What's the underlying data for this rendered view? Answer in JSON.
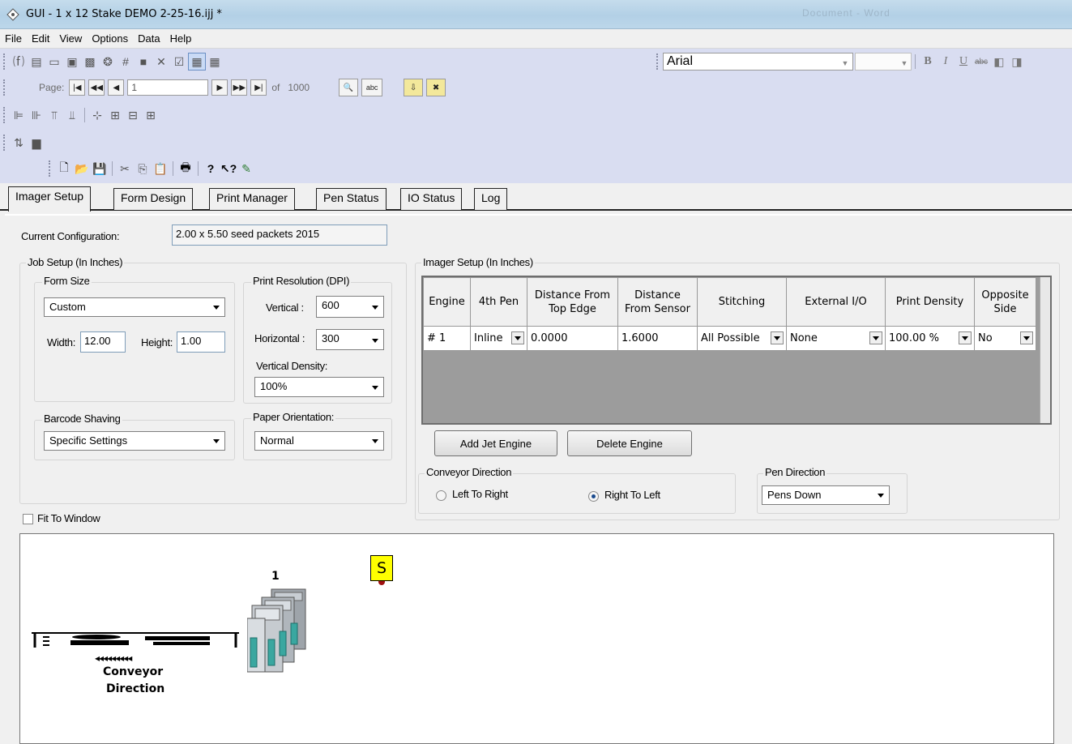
{
  "window": {
    "title": "GUI - 1 x 12 Stake DEMO 2-25-16.ijj *",
    "ghost_title": "Document - Word"
  },
  "menu": [
    "File",
    "Edit",
    "View",
    "Options",
    "Data",
    "Help"
  ],
  "toolbar": {
    "font_name": "Arial",
    "page_label": "Page:",
    "page_value": "1",
    "of_label": "of",
    "total_pages": "1000",
    "abc_label": "abc",
    "format_icons": [
      "bold-icon",
      "italic-icon",
      "underline-icon",
      "strikethrough-icon"
    ]
  },
  "tabs": [
    "Imager Setup",
    "Form Design",
    "Print Manager",
    "Pen Status",
    "IO Status",
    "Log"
  ],
  "current_config": {
    "label": "Current Configuration:",
    "value": "2.00 x 5.50 seed packets 2015"
  },
  "job_setup": {
    "title": "Job Setup (In Inches)",
    "form_size": {
      "title": "Form Size",
      "selected": "Custom",
      "width_label": "Width:",
      "width_value": "12.00",
      "height_label": "Height:",
      "height_value": "1.00"
    },
    "print_resolution": {
      "title": "Print Resolution (DPI)",
      "vertical_label": "Vertical :",
      "vertical_value": "600",
      "horizontal_label": "Horizontal :",
      "horizontal_value": "300",
      "vdensity_label": "Vertical Density:",
      "vdensity_value": "100%"
    },
    "barcode": {
      "title": "Barcode Shaving",
      "selected": "Specific Settings"
    },
    "paper": {
      "title": "Paper Orientation:",
      "selected": "Normal"
    }
  },
  "imager_setup": {
    "title": "Imager Setup (In Inches)",
    "headers": [
      "Engine",
      "4th Pen",
      "Distance From Top Edge",
      "Distance From Sensor",
      "Stitching",
      "External I/O",
      "Print Density",
      "Opposite Side"
    ],
    "rows": [
      [
        "# 1",
        "Inline",
        "0.0000",
        "1.6000",
        "All Possible",
        "None",
        "100.00 %",
        "No"
      ]
    ],
    "add_button": "Add Jet Engine",
    "delete_button": "Delete Engine",
    "conveyor": {
      "title": "Conveyor Direction",
      "option_ltr": "Left To Right",
      "option_rtl": "Right To Left",
      "selected": "Right To Left"
    },
    "pen_direction": {
      "title": "Pen Direction",
      "selected": "Pens Down"
    }
  },
  "fit_to_window": "Fit To Window",
  "canvas": {
    "engine_number": "1",
    "sensor_label": "S",
    "conveyor_arrows": "◂◂◂◂◂◂◂◂◂",
    "conveyor_label_1": "Conveyor",
    "conveyor_label_2": "Direction"
  },
  "colors": {
    "toolbar_bg": "#d9ddf1",
    "sensor_yellow": "#ffff00",
    "engine_teal": "#3aa7a0"
  }
}
